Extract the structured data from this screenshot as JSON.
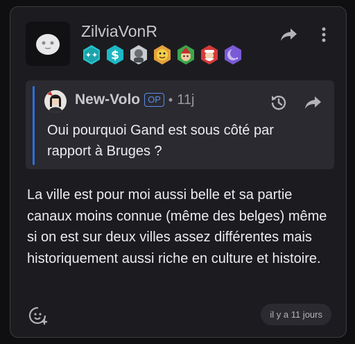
{
  "post": {
    "author": "ZilviaVonR",
    "body": "La ville est pour moi aussi belle et sa partie canaux moins connue (même des belges) même si on est sur deux villes assez différentes mais historiquement aussi riche en culture et histoire.",
    "timestamp": "il y a 11 jours",
    "badges": [
      {
        "name": "stars-badge",
        "color": "#27c2c9"
      },
      {
        "name": "dollar-badge",
        "color": "#1fb7c4"
      },
      {
        "name": "portrait-badge",
        "color": "#9aa2a8"
      },
      {
        "name": "cartoon-badge",
        "color": "#e08a2a"
      },
      {
        "name": "elf-badge",
        "color": "#3aa84a"
      },
      {
        "name": "santa-badge",
        "color": "#d63a3a"
      },
      {
        "name": "moon-badge",
        "color": "#7a5ad6"
      }
    ]
  },
  "quote": {
    "author": "New-Volo",
    "op_label": "OP",
    "separator": "•",
    "time": "11j",
    "text": "Oui pourquoi Gand est sous côté par rapport à Bruges ?"
  },
  "colors": {
    "accent": "#2d6fe0",
    "op": "#5b8de8",
    "card_bg": "#1c1c20",
    "quote_bg": "#2a2a30"
  }
}
